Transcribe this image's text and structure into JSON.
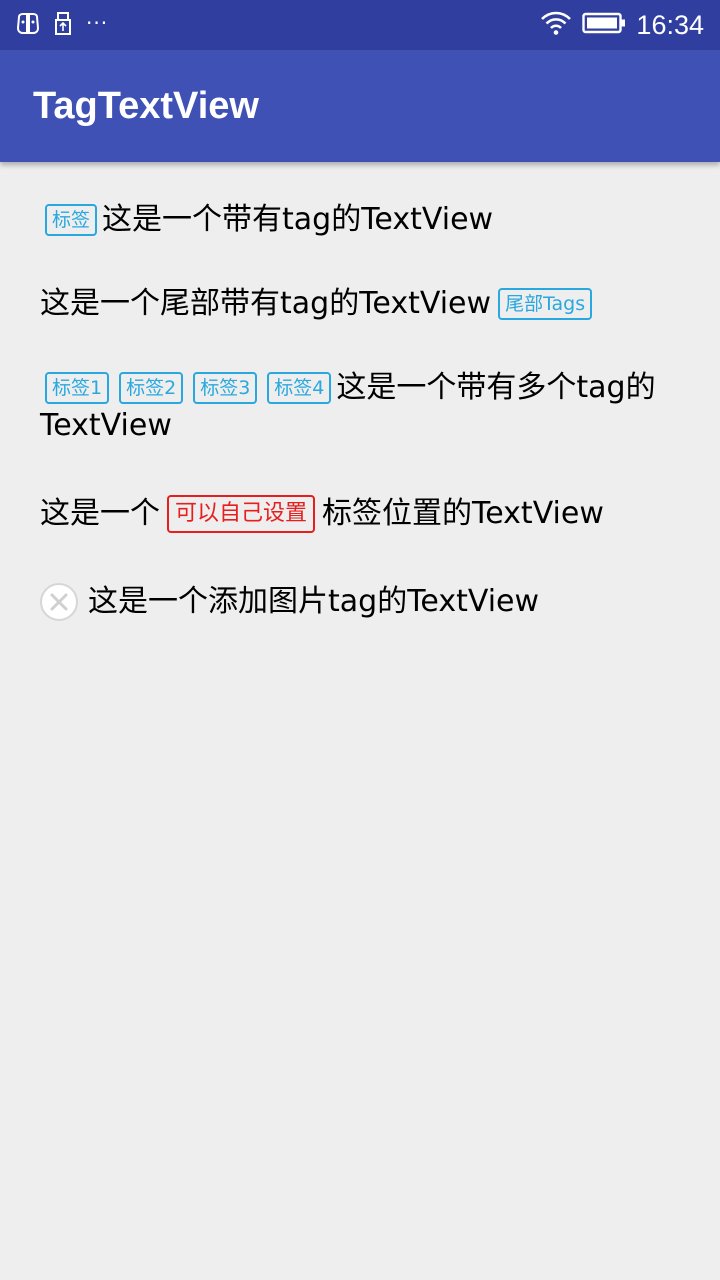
{
  "status_bar": {
    "time": "16:34",
    "left_icons": [
      "face-icon",
      "usb-icon",
      "more-dots-icon"
    ],
    "right_icons": [
      "wifi-icon",
      "battery-icon"
    ],
    "dots": "···"
  },
  "app_bar": {
    "title": "TagTextView"
  },
  "rows": {
    "row1": {
      "tag": "标签",
      "text": "这是一个带有tag的TextView"
    },
    "row2": {
      "text": "这是一个尾部带有tag的TextView",
      "tag": "尾部Tags"
    },
    "row3": {
      "tags": [
        "标签1",
        "标签2",
        "标签3",
        "标签4"
      ],
      "text_line1": "这是一个带有多个tag的",
      "text_line2": "TextView"
    },
    "row4": {
      "text_before": "这是一个",
      "tag": "可以自己设置",
      "text_after": "标签位置的TextView"
    },
    "row5": {
      "icon": "close-circle-icon",
      "text": "这是一个添加图片tag的TextView"
    }
  },
  "colors": {
    "status_bar": "#303f9f",
    "app_bar": "#3f51b5",
    "background": "#eeeeee",
    "tag_blue": "#29a8df",
    "tag_red": "#e81e1e"
  }
}
